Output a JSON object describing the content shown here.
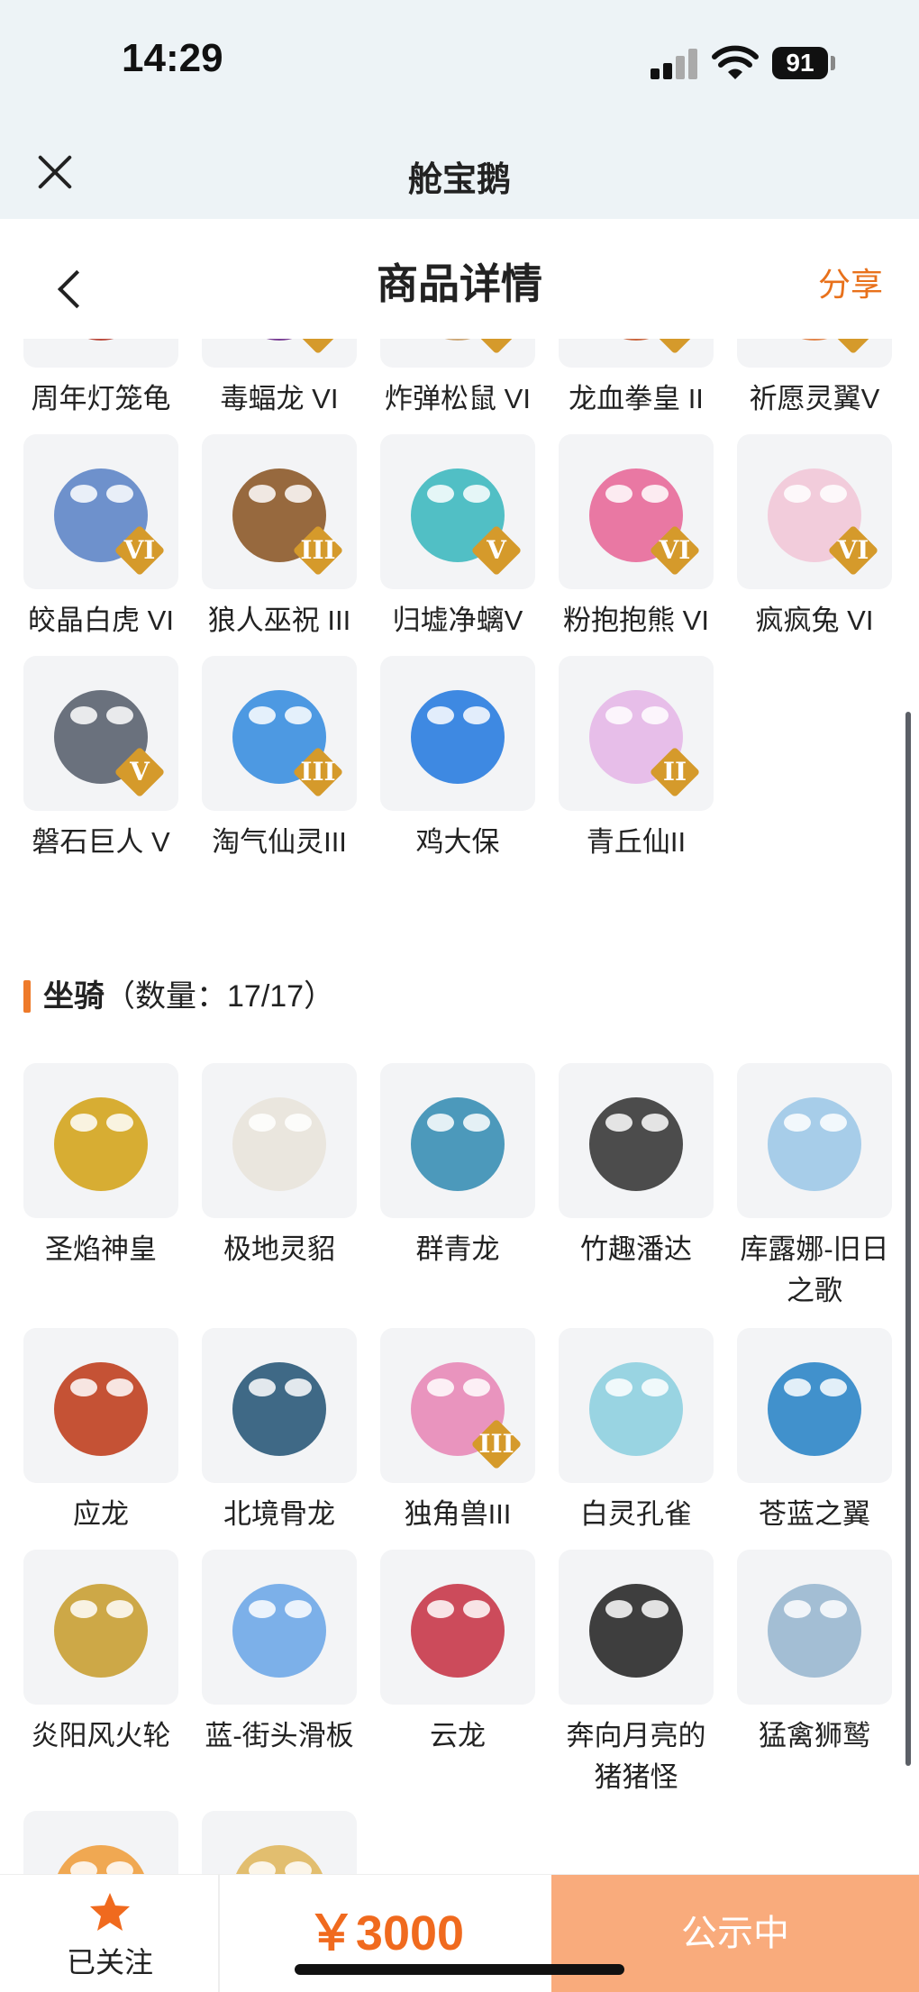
{
  "status_bar": {
    "time": "14:29",
    "battery": "91"
  },
  "app_bar": {
    "title": "舱宝鹅",
    "close_icon": "close-icon"
  },
  "nav_bar": {
    "title": "商品详情",
    "share": "分享",
    "back_icon": "chevron-left-icon"
  },
  "pets": {
    "rows": [
      [
        {
          "name": "周年灯笼龟",
          "tier": "",
          "color": "#b5382a"
        },
        {
          "name": "毒蝠龙 VI",
          "tier": "VI",
          "color": "#6b2a8a"
        },
        {
          "name": "炸弹松鼠 VI",
          "tier": "VI",
          "color": "#c9a06a"
        },
        {
          "name": "龙血拳皇 II",
          "tier": "II",
          "color": "#c5582c"
        },
        {
          "name": "祈愿灵翼V",
          "tier": "V",
          "color": "#e07a3a"
        }
      ],
      [
        {
          "name": "皎晶白虎 VI",
          "tier": "VI",
          "color": "#5f86c8"
        },
        {
          "name": "狼人巫祝 III",
          "tier": "III",
          "color": "#8d5a2a"
        },
        {
          "name": "归墟净螭V",
          "tier": "V",
          "color": "#3fb9c0"
        },
        {
          "name": "粉抱抱熊 VI",
          "tier": "VI",
          "color": "#e86a9a"
        },
        {
          "name": "疯疯兔 VI",
          "tier": "VI",
          "color": "#f2c8d8"
        }
      ],
      [
        {
          "name": "磐石巨人 V",
          "tier": "V",
          "color": "#5b6370"
        },
        {
          "name": "淘气仙灵III",
          "tier": "III",
          "color": "#3b8fe0"
        },
        {
          "name": "鸡大保",
          "tier": "",
          "color": "#2a7de0"
        },
        {
          "name": "青丘仙II",
          "tier": "II",
          "color": "#e6b8e8"
        }
      ]
    ]
  },
  "mounts_section": {
    "title": "坐骑",
    "count_label": "（数量：17/17）"
  },
  "mounts": {
    "rows": [
      [
        {
          "name": "圣焰神皇",
          "tier": "",
          "color": "#d4a51e"
        },
        {
          "name": "极地灵貂",
          "tier": "",
          "color": "#e9e4dc"
        },
        {
          "name": "群青龙",
          "tier": "",
          "color": "#3a8fb5"
        },
        {
          "name": "竹趣潘达",
          "tier": "",
          "color": "#3a3a3a"
        },
        {
          "name": "库露娜-旧日之歌",
          "tier": "",
          "color": "#9fc9e8"
        }
      ],
      [
        {
          "name": "应龙",
          "tier": "",
          "color": "#c04020"
        },
        {
          "name": "北境骨龙",
          "tier": "",
          "color": "#2b5a7a"
        },
        {
          "name": "独角兽III",
          "tier": "III",
          "color": "#e88ab8"
        },
        {
          "name": "白灵孔雀",
          "tier": "",
          "color": "#8fd0e0"
        },
        {
          "name": "苍蓝之翼",
          "tier": "",
          "color": "#2e86c8"
        }
      ],
      [
        {
          "name": "炎阳风火轮",
          "tier": "",
          "color": "#c9a034"
        },
        {
          "name": "蓝-街头滑板",
          "tier": "",
          "color": "#6fa8e8"
        },
        {
          "name": "云龙",
          "tier": "",
          "color": "#c8384a"
        },
        {
          "name": "奔向月亮的猪猪怪",
          "tier": "",
          "color": "#2a2a2a"
        },
        {
          "name": "猛禽狮鹫",
          "tier": "",
          "color": "#9ab8d0"
        }
      ],
      [
        {
          "name": "",
          "tier": "",
          "color": "#f0a040"
        },
        {
          "name": "",
          "tier": "",
          "color": "#e0b860"
        }
      ]
    ]
  },
  "bottom_bar": {
    "follow_label": "已关注",
    "price": "￥3000",
    "status_button": "公示中"
  },
  "colors": {
    "accent": "#f06a1e",
    "cta": "#f9ab7c",
    "header_bg": "#edf3f6"
  }
}
